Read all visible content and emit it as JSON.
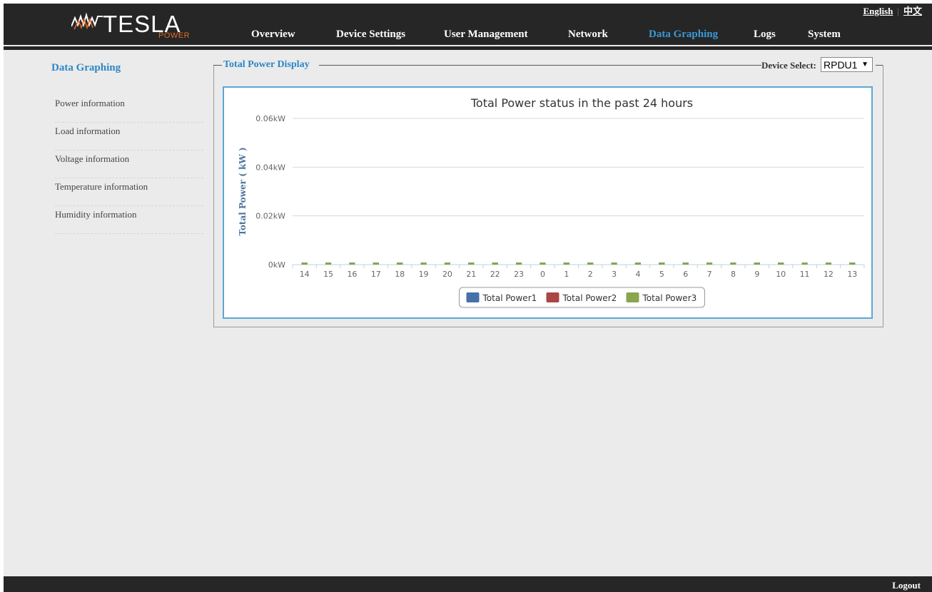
{
  "header": {
    "logo_text": "TESLA",
    "logo_sub": "POWER",
    "lang_english": "English",
    "lang_chinese": "中文",
    "nav": [
      "Overview",
      "Device Settings",
      "User Management",
      "Network",
      "Data Graphing",
      "Logs",
      "System"
    ],
    "active_nav": "Data Graphing"
  },
  "sidebar": {
    "title": "Data Graphing",
    "items": [
      "Power information",
      "Load information",
      "Voltage information",
      "Temperature information",
      "Humidity information"
    ]
  },
  "panel": {
    "legend": "Total Power Display",
    "device_select_label": "Device Select:",
    "device_select_value": "RPDU1"
  },
  "footer": {
    "logout": "Logout"
  },
  "chart_data": {
    "type": "bar",
    "title": "Total Power status in the past 24 hours",
    "ylabel": "Total Power ( kW )",
    "ytick_labels": [
      "0kW",
      "0.02kW",
      "0.04kW",
      "0.06kW"
    ],
    "ylim": [
      0,
      0.06
    ],
    "categories": [
      "14",
      "15",
      "16",
      "17",
      "18",
      "19",
      "20",
      "21",
      "22",
      "23",
      "0",
      "1",
      "2",
      "3",
      "4",
      "5",
      "6",
      "7",
      "8",
      "9",
      "10",
      "11",
      "12",
      "13"
    ],
    "series": [
      {
        "name": "Total Power1",
        "color": "#4572a7",
        "values": [
          0,
          0,
          0,
          0,
          0,
          0,
          0,
          0,
          0,
          0,
          0,
          0,
          0,
          0,
          0,
          0,
          0,
          0,
          0,
          0,
          0,
          0,
          0,
          0
        ]
      },
      {
        "name": "Total Power2",
        "color": "#aa4643",
        "values": [
          0,
          0,
          0,
          0,
          0,
          0,
          0,
          0,
          0,
          0,
          0,
          0,
          0,
          0,
          0,
          0,
          0,
          0,
          0,
          0,
          0,
          0,
          0,
          0
        ]
      },
      {
        "name": "Total Power3",
        "color": "#89a54e",
        "values": [
          0,
          0,
          0,
          0,
          0,
          0,
          0,
          0,
          0,
          0,
          0,
          0,
          0,
          0,
          0,
          0,
          0,
          0,
          0,
          0,
          0,
          0,
          0,
          0
        ]
      }
    ],
    "legend_position": "bottom",
    "grid": true
  }
}
